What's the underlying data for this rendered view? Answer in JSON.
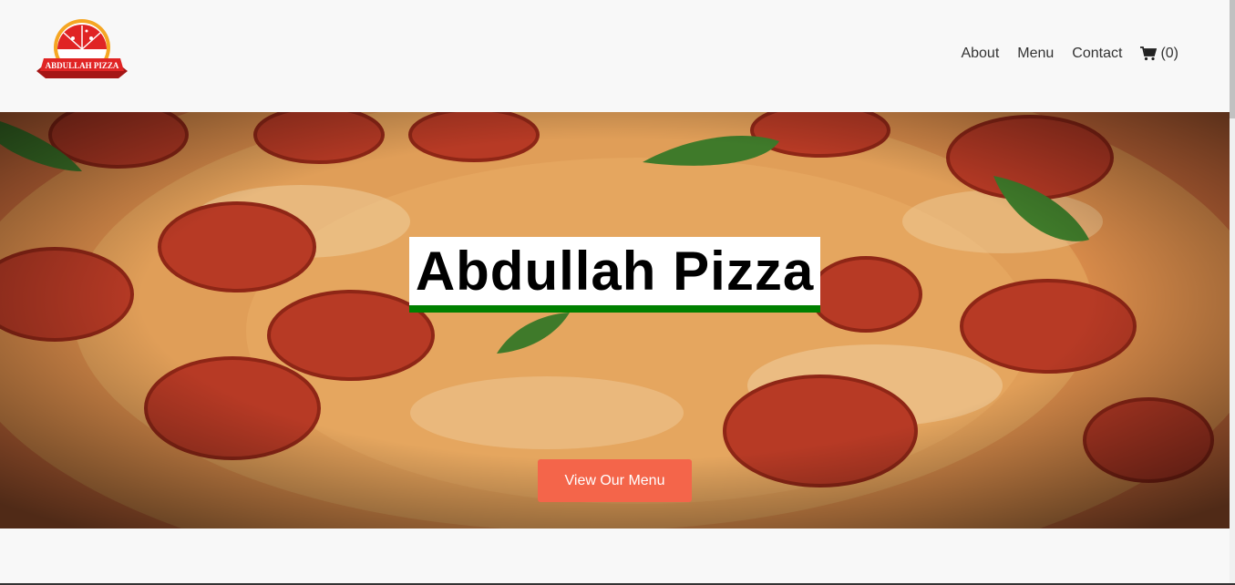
{
  "logo": {
    "text": "ABDULLAH PIZZA"
  },
  "nav": {
    "items": [
      {
        "label": "About"
      },
      {
        "label": "Menu"
      },
      {
        "label": "Contact"
      }
    ],
    "cart_count": "(0)"
  },
  "hero": {
    "title": "Abdullah Pizza",
    "cta_label": "View Our Menu"
  },
  "colors": {
    "accent": "#f4654a",
    "title_underline": "#008000",
    "logo_red": "#e02424",
    "logo_yellow": "#f5a623"
  }
}
